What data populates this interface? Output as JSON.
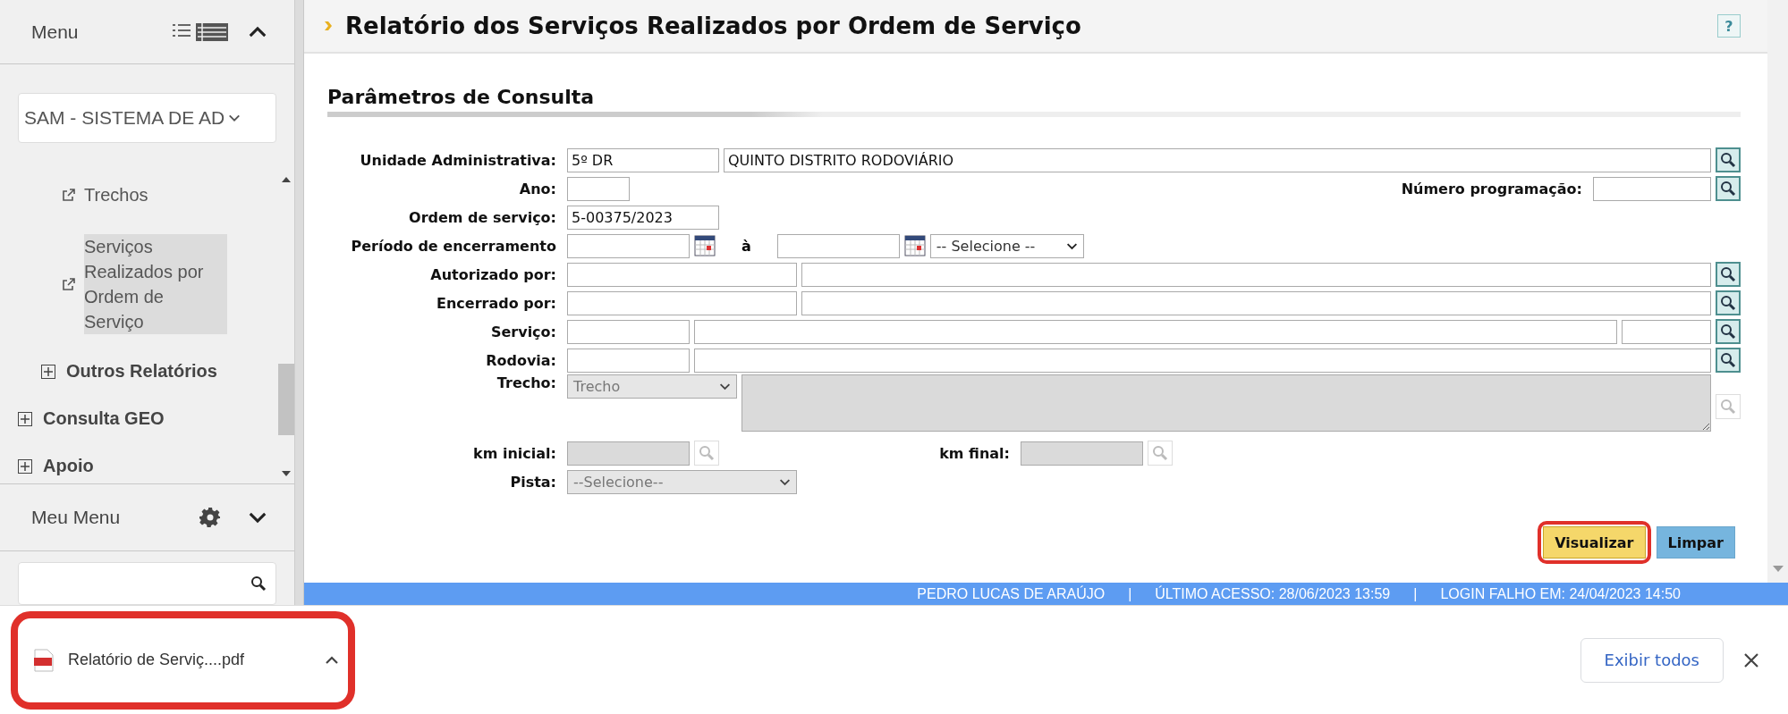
{
  "sidebar": {
    "menu_title": "Menu",
    "system_select": "SAM - SISTEMA DE AD",
    "tree": [
      {
        "kind": "group",
        "children": [
          {
            "kind": "group",
            "children": [
              {
                "kind": "link",
                "label": "Trechos",
                "selected": false
              },
              {
                "kind": "link",
                "label": "Serviços Realizados por Ordem de Serviço",
                "selected": true
              }
            ]
          },
          {
            "kind": "group",
            "label": "Outros Relatórios",
            "expanded": false
          }
        ]
      },
      {
        "kind": "group",
        "label": "Consulta GEO",
        "expanded": false
      },
      {
        "kind": "group",
        "label": "Apoio",
        "expanded": false
      }
    ],
    "my_menu": {
      "title": "Meu Menu",
      "expanded": false
    }
  },
  "page_header": {
    "title": "Relatório dos Serviços Realizados por Ordem de Serviço",
    "help": "?"
  },
  "form": {
    "section_title": "Parâmetros de Consulta",
    "unidade": {
      "label": "Unidade Administrativa:",
      "code": "5º DR",
      "name": "QUINTO DISTRITO RODOVIÁRIO"
    },
    "ano": {
      "label": "Ano:"
    },
    "numero_programacao": {
      "label": "Número programação:"
    },
    "ordem_servico": {
      "label": "Ordem de serviço:",
      "value": "5-00375/2023"
    },
    "periodo": {
      "label": "Período de encerramento",
      "separator": "à",
      "select": "-- Selecione --"
    },
    "autorizado_por": {
      "label": "Autorizado por:"
    },
    "encerrado_por": {
      "label": "Encerrado por:"
    },
    "servico": {
      "label": "Serviço:"
    },
    "rodovia": {
      "label": "Rodovia:"
    },
    "trecho": {
      "label": "Trecho:",
      "select": "Trecho",
      "disabled": true
    },
    "km_inicial": {
      "label": "km inicial:",
      "disabled": true
    },
    "km_final": {
      "label": "km final:",
      "disabled": true
    },
    "pista": {
      "label": "Pista:",
      "select": "--Selecione--",
      "disabled": true
    },
    "buttons": [
      {
        "kind": "primary",
        "label": "Visualizar",
        "highlighted": true
      },
      {
        "kind": "secondary",
        "label": "Limpar",
        "highlighted": false
      }
    ]
  },
  "status_bar": {
    "parts": [
      "PEDRO LUCAS DE ARAÚJO",
      "|",
      "ÚLTIMO ACESSO: 28/06/2023 13:59",
      "|",
      "LOGIN FALHO EM: 24/04/2023 14:50"
    ]
  },
  "download_bar": {
    "file": "Relatório de Serviç....pdf",
    "highlighted": true,
    "show_all": "Exibir todos"
  }
}
